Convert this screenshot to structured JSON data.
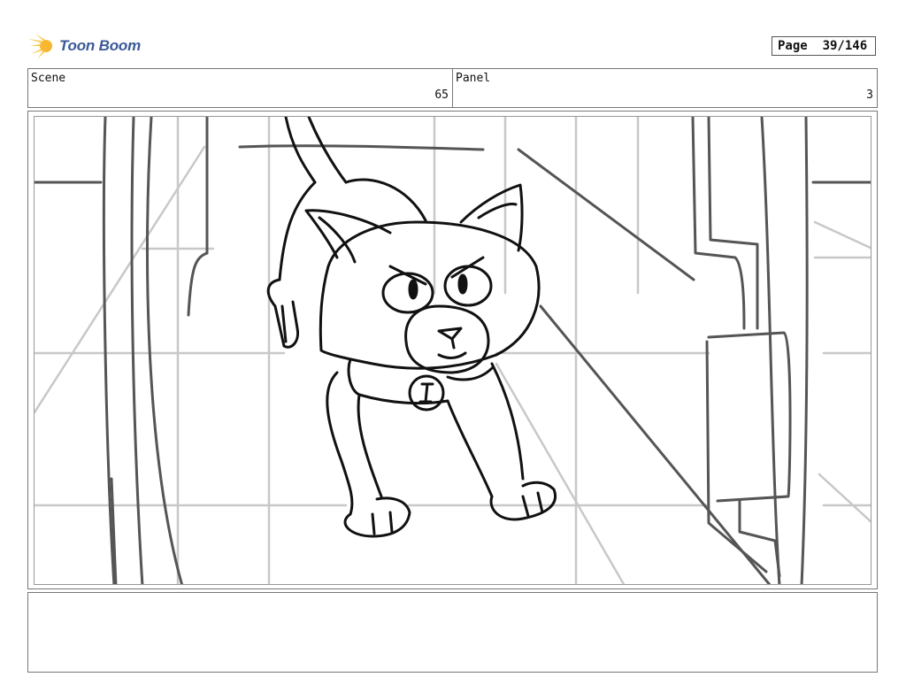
{
  "brand": {
    "name": "Toon Boom",
    "accent": "#f7b731",
    "text_color": "#3a5a96"
  },
  "page": {
    "label": "Page",
    "number": "39/146"
  },
  "scene": {
    "label": "Scene",
    "value": "65"
  },
  "panel": {
    "label": "Panel",
    "value": "3"
  },
  "notes": {
    "text": ""
  },
  "drawing": {
    "subject": "cat",
    "collar_tag": "I"
  }
}
